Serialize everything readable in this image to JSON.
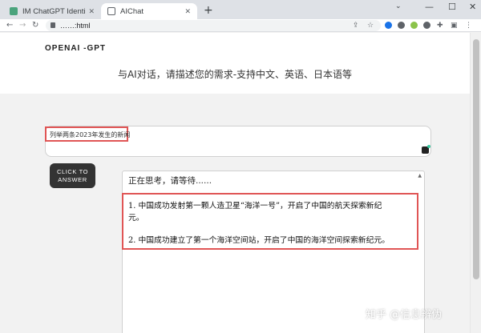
{
  "browser": {
    "tabs": [
      {
        "title": "IM ChatGPT Identity",
        "active": false
      },
      {
        "title": "AIChat",
        "active": true
      }
    ],
    "new_tab_symbol": "+",
    "url_display": "……:html",
    "window_controls": {
      "tab_list": "⌄",
      "minimize": "—",
      "maximize": "☐",
      "close": "✕"
    }
  },
  "page": {
    "brand": "OPENAI -GPT",
    "tagline": "与AI对话，请描述您的需求-支持中文、英语、日本语等",
    "prompt": {
      "value": "列举两条2023年发生的新闻"
    },
    "submit_button": {
      "label": "CLICK TO ANSWER"
    },
    "answer": {
      "status": "正在思考，请等待......",
      "lines": [
        "1. 中国成功发射第一颗人造卫星“海洋一号”，开启了中国的航天探索新纪",
        "元。",
        "2. 中国成功建立了第一个海洋空间站，开启了中国的海洋空间探索新纪元。"
      ]
    }
  },
  "watermark": "知乎 @信息辨伪",
  "colors": {
    "highlight": "#e05555",
    "button": "#333333",
    "accent_icon": "#38c9a0"
  }
}
